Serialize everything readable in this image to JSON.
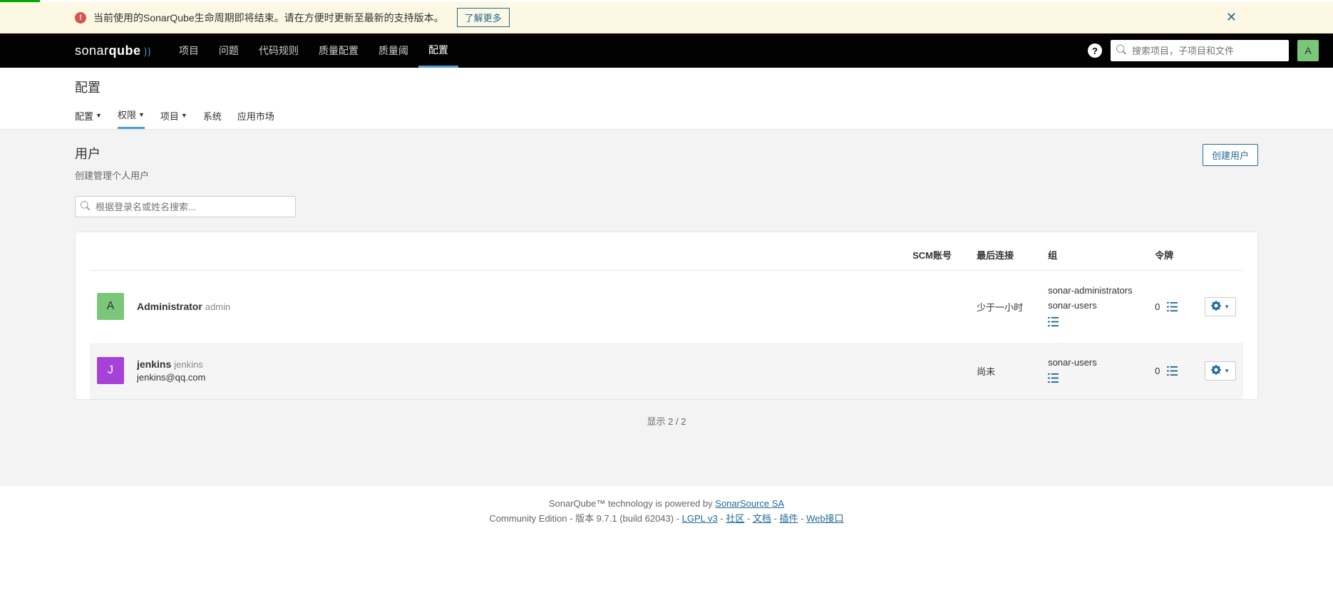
{
  "banner": {
    "text": "当前使用的SonarQube生命周期即将结束。请在方便时更新至最新的支持版本。",
    "link": "了解更多"
  },
  "nav": {
    "logo_prefix": "sonar",
    "logo_suffix": "qube",
    "items": [
      "项目",
      "问题",
      "代码规则",
      "质量配置",
      "质量阈",
      "配置"
    ],
    "active_index": 5,
    "search_placeholder": "搜索项目，子项目和文件",
    "avatar_letter": "A"
  },
  "subheader": {
    "title": "配置",
    "items": [
      "配置",
      "权限",
      "项目",
      "系统",
      "应用市场"
    ],
    "has_caret": [
      true,
      true,
      true,
      false,
      false
    ],
    "active_index": 1
  },
  "page": {
    "title": "用户",
    "desc": "创建管理个人用户",
    "create_btn": "创建用户",
    "filter_placeholder": "根据登录名或姓名搜索...",
    "count_text": "显示 2 / 2"
  },
  "table": {
    "headers": {
      "scm": "SCM账号",
      "last": "最后连接",
      "groups": "组",
      "tokens": "令牌"
    },
    "rows": [
      {
        "avatar_letter": "A",
        "avatar_class": "avatar-green",
        "name": "Administrator",
        "login": "admin",
        "email": "",
        "last": "少于一小时",
        "groups": [
          "sonar-administrators",
          "sonar-users"
        ],
        "tokens": "0"
      },
      {
        "avatar_letter": "J",
        "avatar_class": "avatar-purple",
        "name": "jenkins",
        "login": "jenkins",
        "email": "jenkins@qq.com",
        "last": "尚未",
        "groups": [
          "sonar-users"
        ],
        "tokens": "0"
      }
    ]
  },
  "footer": {
    "line1_prefix": "SonarQube™ technology is powered by ",
    "line1_link": "SonarSource SA",
    "line2_prefix": "Community Edition - 版本 9.7.1 (build 62043) - ",
    "links": [
      "LGPL v3",
      "社区",
      "文档",
      "插件",
      "Web接口"
    ]
  }
}
